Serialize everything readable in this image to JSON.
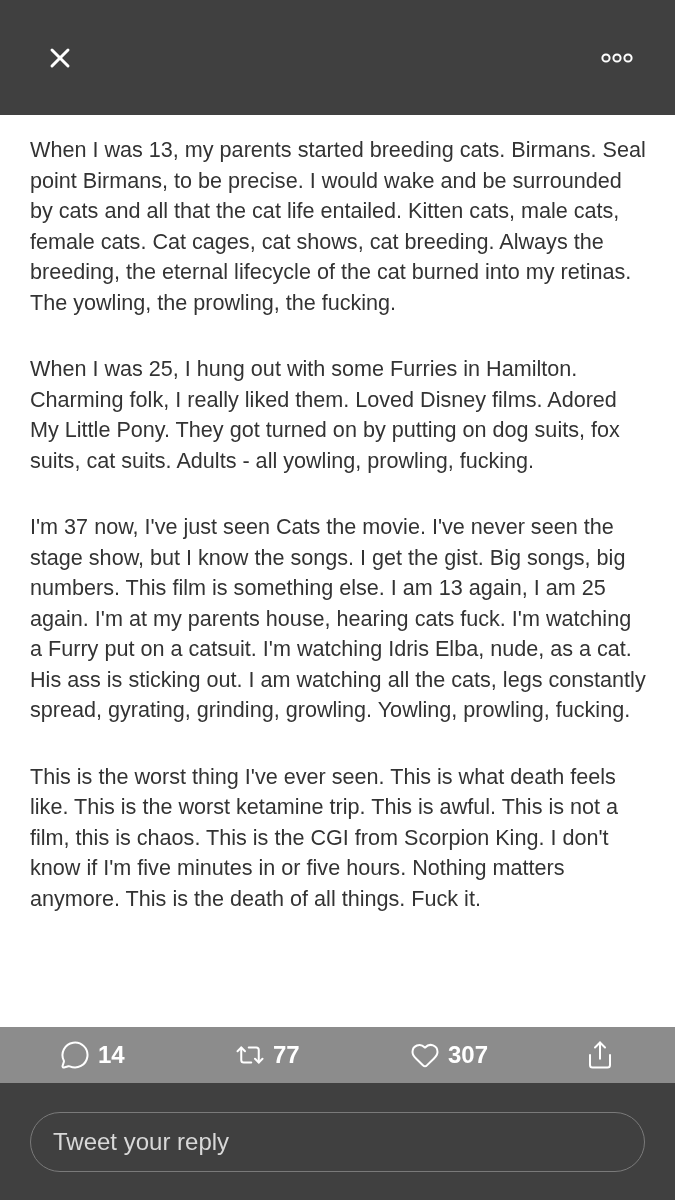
{
  "paragraphs": [
    "When I was 13, my parents started breeding cats. Birmans. Seal point Birmans, to be precise. I would wake and be surrounded by cats and all that the cat life entailed. Kitten cats, male cats, female cats. Cat cages, cat shows, cat breeding. Always the breeding, the eternal lifecycle of the cat burned into my retinas. The yowling, the prowling, the fucking.",
    "When I was 25, I hung out with some Furries in Hamilton. Charming folk, I really liked them. Loved Disney films. Adored My Little Pony. They got turned on by putting on dog suits, fox suits, cat suits. Adults - all yowling, prowling, fucking.",
    "I'm 37 now, I've just seen Cats the movie. I've never seen the stage show, but I know the songs. I get the gist. Big songs, big numbers. This film is something else. I am 13 again, I am 25 again. I'm at my parents house, hearing cats fuck. I'm watching a Furry put on a catsuit. I'm watching Idris Elba, nude, as a cat. His ass is sticking out. I am watching all the cats, legs constantly spread, gyrating, grinding, growling. Yowling, prowling, fucking.",
    "This is the worst thing I've ever seen. This is what death feels like. This is the worst ketamine trip. This is awful. This is not a film, this is chaos. This is the CGI from Scorpion King. I don't know if I'm five minutes in or five hours. Nothing matters anymore. This is the death of all things. Fuck it."
  ],
  "actions": [
    {
      "kind": "reply",
      "count": "14"
    },
    {
      "kind": "retweet",
      "count": "77"
    },
    {
      "kind": "like",
      "count": "307"
    },
    {
      "kind": "share"
    }
  ],
  "reply_field": {
    "placeholder": "Tweet your reply"
  }
}
